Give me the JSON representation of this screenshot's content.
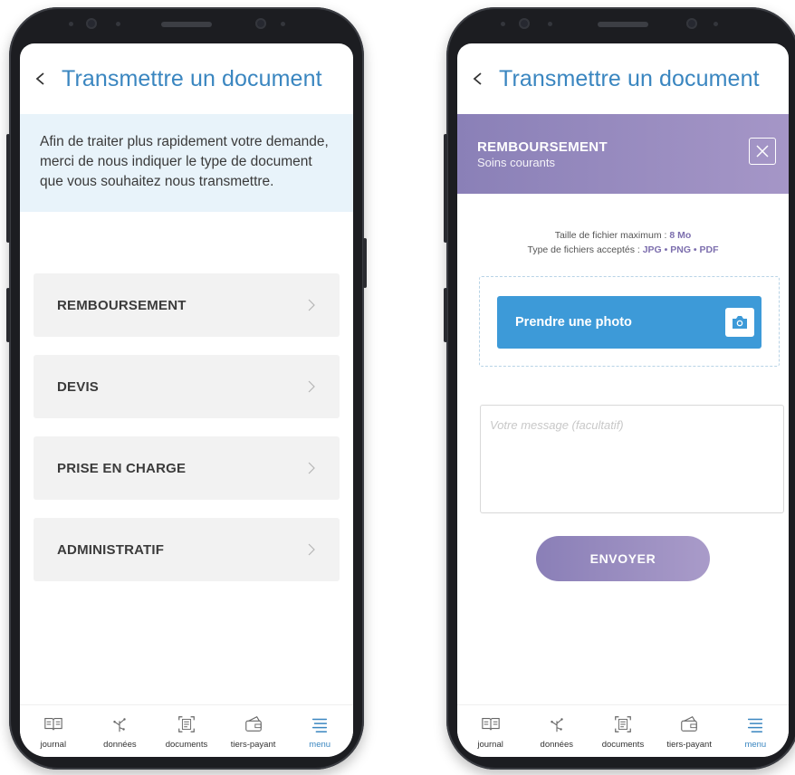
{
  "left_screen": {
    "header": {
      "title": "Transmettre un document"
    },
    "info": "Afin de traiter plus rapidement votre demande, merci de nous indiquer le type de document que vous souhaitez nous transmettre.",
    "options": [
      {
        "label": "REMBOURSEMENT"
      },
      {
        "label": "DEVIS"
      },
      {
        "label": "PRISE EN CHARGE"
      },
      {
        "label": "ADMINISTRATIF"
      }
    ]
  },
  "right_screen": {
    "header": {
      "title": "Transmettre un document"
    },
    "banner": {
      "title": "REMBOURSEMENT",
      "subtitle": "Soins courants"
    },
    "file_info": {
      "max_label": "Taille de fichier maximum : ",
      "max_value": "8 Mo",
      "types_label": "Type de fichiers acceptés : ",
      "types_value": "JPG • PNG • PDF"
    },
    "photo_button": "Prendre une photo",
    "message_placeholder": "Votre message (facultatif)",
    "send_button": "ENVOYER"
  },
  "bottom_nav": {
    "items": [
      {
        "label": "journal",
        "icon": "book-icon"
      },
      {
        "label": "données",
        "icon": "chart-tree-icon"
      },
      {
        "label": "documents",
        "icon": "scan-doc-icon"
      },
      {
        "label": "tiers-payant",
        "icon": "card-wallet-icon"
      },
      {
        "label": "menu",
        "icon": "menu-lines-icon"
      }
    ],
    "active": "menu"
  },
  "colors": {
    "title_blue": "#3a86c0",
    "info_bg": "#e8f3fa",
    "banner_purple": "#8a80b7",
    "photo_blue": "#3d9ad8",
    "send_purple": "#9b8ec2"
  }
}
